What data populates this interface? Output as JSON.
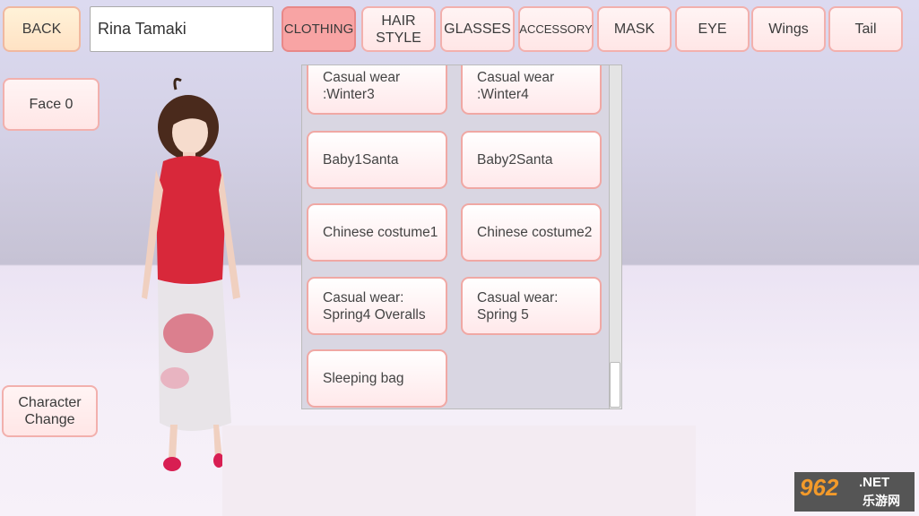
{
  "top": {
    "back": "BACK",
    "name_value": "Rina Tamaki",
    "tabs": [
      "CLOTHING",
      "HAIR STYLE",
      "GLASSES",
      "ACCESSORY",
      "MASK",
      "EYE",
      "Wings",
      "Tail"
    ],
    "active_tab": "CLOTHING"
  },
  "left": {
    "face": "Face 0",
    "character_change": "Character Change"
  },
  "items": [
    "Casual wear :Winter3",
    "Casual wear :Winter4",
    "Baby1Santa",
    "Baby2Santa",
    "Chinese costume1",
    "Chinese costume2",
    "Casual wear: Spring4 Overalls",
    "Casual wear: Spring 5",
    "Sleeping bag"
  ],
  "watermark": {
    "text": "962.NET",
    "sub": "乐游网"
  },
  "colors": {
    "active_tab": "#f8a4a4",
    "button_border": "#f2b0ad",
    "dress": "#d8283a"
  }
}
